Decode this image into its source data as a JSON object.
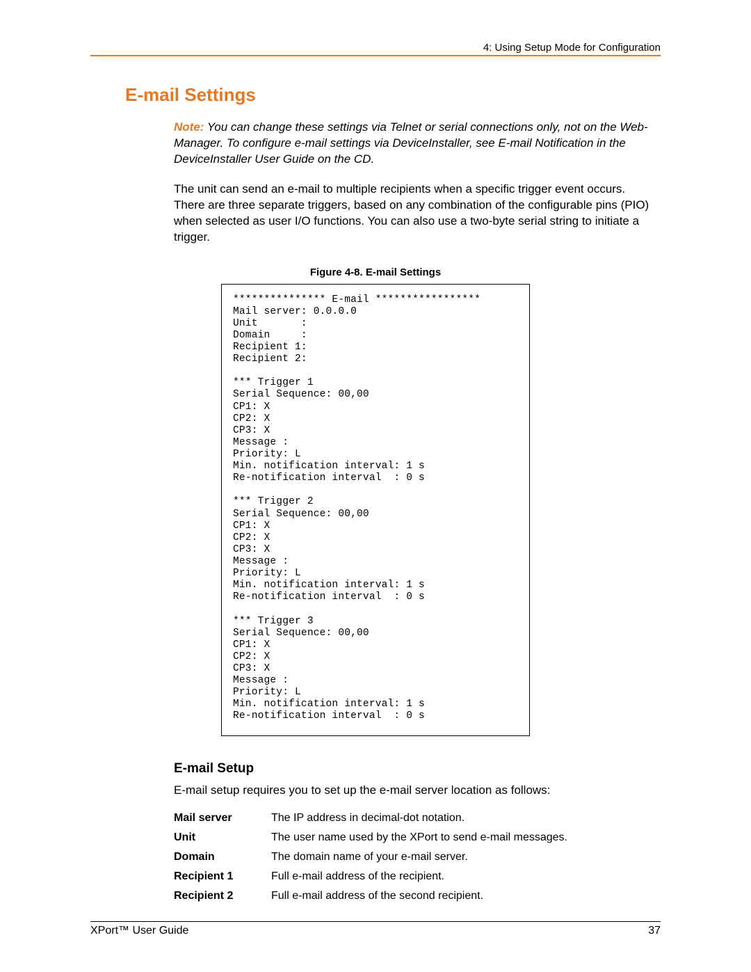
{
  "header": {
    "running": "4: Using Setup Mode for Configuration"
  },
  "title": "E-mail Settings",
  "note": {
    "label": "Note:",
    "text": " You can change these settings via Telnet or serial connections only, not on the Web-Manager. To configure e-mail settings via DeviceInstaller, see E-mail Notification in the DeviceInstaller User Guide on the CD."
  },
  "intro": "The unit can send an e-mail to multiple recipients when a specific trigger event occurs. There are three separate triggers, based on any combination of the configurable pins (PIO) when selected as user I/O functions. You can also use a two-byte serial string to initiate a trigger.",
  "figure": {
    "caption": "Figure 4-8. E-mail Settings"
  },
  "terminal": "*************** E-mail *****************\nMail server: 0.0.0.0\nUnit       :\nDomain     :\nRecipient 1:\nRecipient 2:\n\n*** Trigger 1\nSerial Sequence: 00,00\nCP1: X\nCP2: X\nCP3: X\nMessage :\nPriority: L\nMin. notification interval: 1 s\nRe-notification interval  : 0 s\n\n*** Trigger 2\nSerial Sequence: 00,00\nCP1: X\nCP2: X\nCP3: X\nMessage :\nPriority: L\nMin. notification interval: 1 s\nRe-notification interval  : 0 s\n\n*** Trigger 3\nSerial Sequence: 00,00\nCP1: X\nCP2: X\nCP3: X\nMessage :\nPriority: L\nMin. notification interval: 1 s\nRe-notification interval  : 0 s",
  "setup": {
    "heading": "E-mail Setup",
    "intro": "E-mail setup requires you to set up the e-mail server location as follows:",
    "rows": [
      {
        "label": "Mail server",
        "desc": "The IP address in decimal-dot notation."
      },
      {
        "label": "Unit",
        "desc": "The user name used by the XPort to send e-mail messages."
      },
      {
        "label": "Domain",
        "desc": "The domain name of your e-mail server."
      },
      {
        "label": "Recipient 1",
        "desc": "Full e-mail address of the recipient."
      },
      {
        "label": "Recipient 2",
        "desc": "Full e-mail address of the second recipient."
      }
    ]
  },
  "footer": {
    "left": "XPort™ User Guide",
    "right": "37"
  }
}
